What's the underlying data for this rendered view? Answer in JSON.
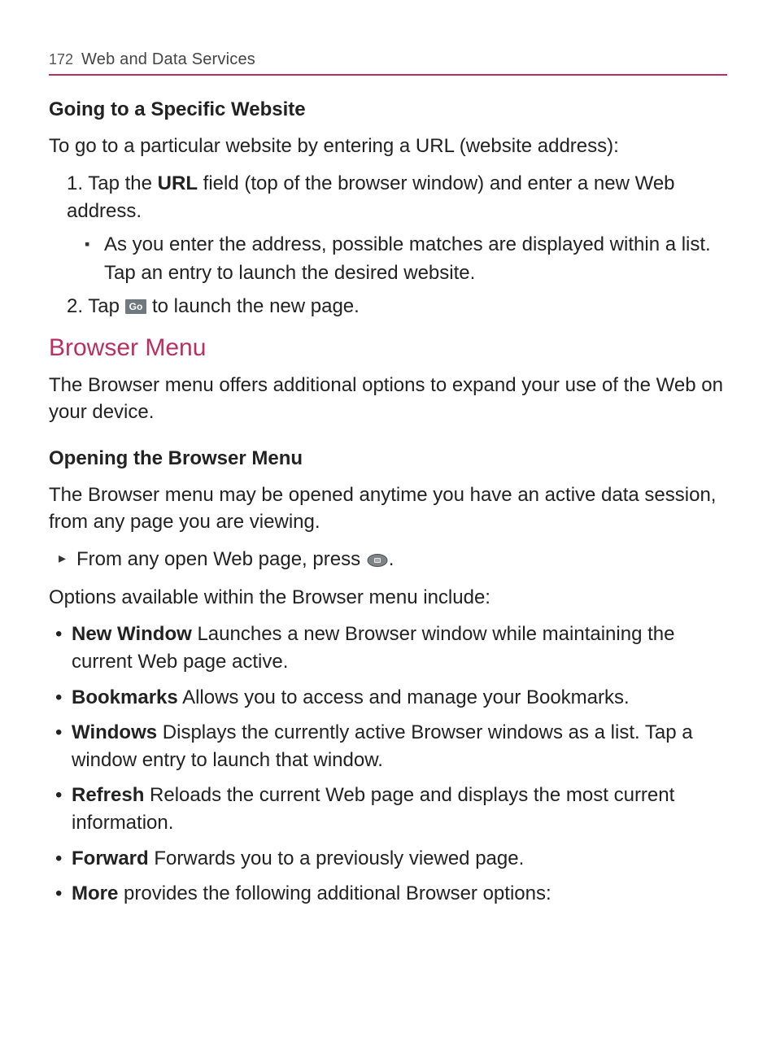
{
  "header": {
    "page_number": "172",
    "title": "Web and Data Services"
  },
  "section1": {
    "subheading": "Going to a Specific Website",
    "intro": "To go to a particular website by entering a URL (website address):",
    "steps": [
      {
        "num": "1.",
        "pre": "Tap the ",
        "bold": "URL",
        "post": " field (top of the browser window) and enter a new Web address.",
        "sub": "As you enter the address, possible matches are displayed within a list. Tap an entry to launch the desired website."
      },
      {
        "num": "2.",
        "pre": "Tap ",
        "go_label": "Go",
        "post": " to launch the new page."
      }
    ]
  },
  "section2": {
    "heading": "Browser Menu",
    "intro": "The Browser menu offers additional options to expand your use of the Web on your device."
  },
  "section3": {
    "subheading": "Opening the Browser Menu",
    "intro": "The Browser menu may be opened anytime you have an active data session, from any page you are viewing.",
    "tri": "From any open Web page, press ",
    "tri_period": ".",
    "options_intro": "Options available within the Browser menu include:",
    "options": [
      {
        "bold": "New Window",
        "text": " Launches a new Browser window while maintaining the current Web page active."
      },
      {
        "bold": "Bookmarks",
        "text": " Allows you to access and manage your Bookmarks."
      },
      {
        "bold": "Windows",
        "text": " Displays the currently active Browser windows as a list. Tap a window entry to launch that window."
      },
      {
        "bold": "Refresh",
        "text": " Reloads the current Web page and displays the most current information."
      },
      {
        "bold": "Forward",
        "text": " Forwards you to a previously viewed page."
      },
      {
        "bold": "More",
        "text": " provides the following additional Browser options:"
      }
    ]
  }
}
